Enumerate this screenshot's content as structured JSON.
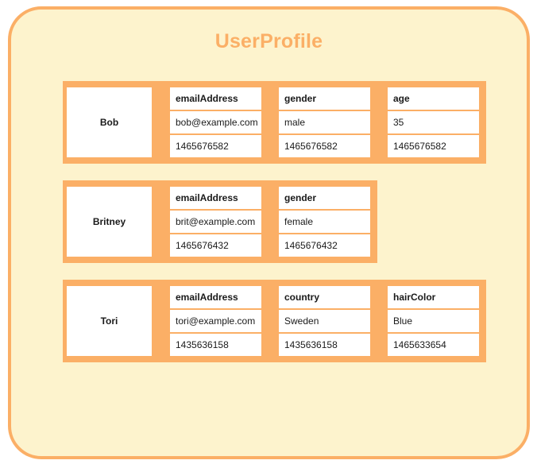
{
  "diagram": {
    "title": "UserProfile",
    "colors": {
      "container_fill": "#fdf3cd",
      "container_border": "#fbaf66",
      "band_fill": "#fbaf66",
      "cell_fill": "#ffffff",
      "title_text": "#fbaf66",
      "cell_text": "#1a1a1a"
    },
    "records": [
      {
        "name": "Bob",
        "attributes": [
          {
            "key": "emailAddress",
            "value": "bob@example.com",
            "timestamp": "1465676582"
          },
          {
            "key": "gender",
            "value": "male",
            "timestamp": "1465676582"
          },
          {
            "key": "age",
            "value": "35",
            "timestamp": "1465676582"
          }
        ]
      },
      {
        "name": "Britney",
        "attributes": [
          {
            "key": "emailAddress",
            "value": "brit@example.com",
            "timestamp": "1465676432"
          },
          {
            "key": "gender",
            "value": "female",
            "timestamp": "1465676432"
          }
        ]
      },
      {
        "name": "Tori",
        "attributes": [
          {
            "key": "emailAddress",
            "value": "tori@example.com",
            "timestamp": "1435636158"
          },
          {
            "key": "country",
            "value": "Sweden",
            "timestamp": "1435636158"
          },
          {
            "key": "hairColor",
            "value": "Blue",
            "timestamp": "1465633654"
          }
        ]
      }
    ]
  }
}
